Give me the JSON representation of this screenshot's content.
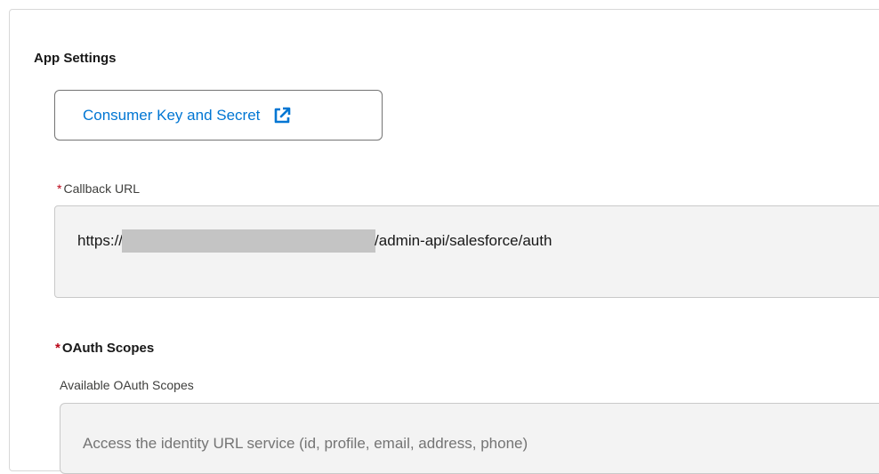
{
  "app_settings": {
    "title": "App Settings",
    "consumer_key_button": {
      "label": "Consumer Key and Secret",
      "icon": "external-link-icon",
      "color": "#0176d3"
    }
  },
  "callback_url": {
    "required_marker": "*",
    "label": "Callback URL",
    "value_prefix": "https://",
    "value_suffix": "/admin-api/salesforce/auth"
  },
  "oauth_scopes": {
    "required_marker": "*",
    "title": "OAuth Scopes",
    "available_label": "Available OAuth Scopes",
    "available_items": [
      "Access the identity URL service (id, profile, email, address, phone)"
    ]
  }
}
